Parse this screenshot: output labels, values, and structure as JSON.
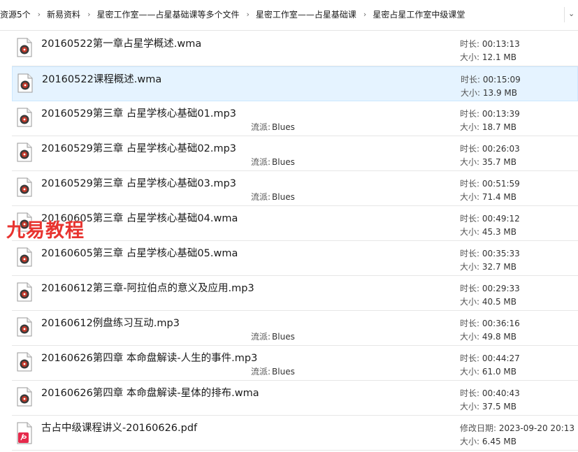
{
  "breadcrumb": {
    "items": [
      "资源5个",
      "新易资料",
      "星密工作室——占星基础课等多个文件",
      "星密工作室——占星基础课",
      "星密占星工作室中级课堂"
    ]
  },
  "labels": {
    "duration": "时长:",
    "size": "大小:",
    "genre": "流派:",
    "modified": "修改日期:"
  },
  "watermark": "九易教程",
  "files": [
    {
      "name": "20160522第一章占星学概述.wma",
      "type": "audio",
      "duration": "00:13:13",
      "size": "12.1 MB",
      "genre": ""
    },
    {
      "name": "20160522课程概述.wma",
      "type": "audio",
      "duration": "00:15:09",
      "size": "13.9 MB",
      "genre": "",
      "selected": true
    },
    {
      "name": "20160529第三章 占星学核心基础01.mp3",
      "type": "audio",
      "duration": "00:13:39",
      "size": "18.7 MB",
      "genre": "Blues"
    },
    {
      "name": "20160529第三章 占星学核心基础02.mp3",
      "type": "audio",
      "duration": "00:26:03",
      "size": "35.7 MB",
      "genre": "Blues"
    },
    {
      "name": "20160529第三章 占星学核心基础03.mp3",
      "type": "audio",
      "duration": "00:51:59",
      "size": "71.4 MB",
      "genre": "Blues"
    },
    {
      "name": "20160605第三章 占星学核心基础04.wma",
      "type": "audio",
      "duration": "00:49:12",
      "size": "45.3 MB",
      "genre": ""
    },
    {
      "name": "20160605第三章 占星学核心基础05.wma",
      "type": "audio",
      "duration": "00:35:33",
      "size": "32.7 MB",
      "genre": ""
    },
    {
      "name": "20160612第三章-阿拉伯点的意义及应用.mp3",
      "type": "audio",
      "duration": "00:29:33",
      "size": "40.5 MB",
      "genre": ""
    },
    {
      "name": "20160612例盘练习互动.mp3",
      "type": "audio",
      "duration": "00:36:16",
      "size": "49.8 MB",
      "genre": "Blues"
    },
    {
      "name": "20160626第四章 本命盘解读-人生的事件.mp3",
      "type": "audio",
      "duration": "00:44:27",
      "size": "61.0 MB",
      "genre": "Blues"
    },
    {
      "name": "20160626第四章 本命盘解读-星体的排布.wma",
      "type": "audio",
      "duration": "00:40:43",
      "size": "37.5 MB",
      "genre": ""
    },
    {
      "name": "古占中级课程讲义-20160626.pdf",
      "type": "pdf",
      "modified": "2023-09-20 20:13",
      "size": "6.45 MB",
      "genre": ""
    }
  ]
}
